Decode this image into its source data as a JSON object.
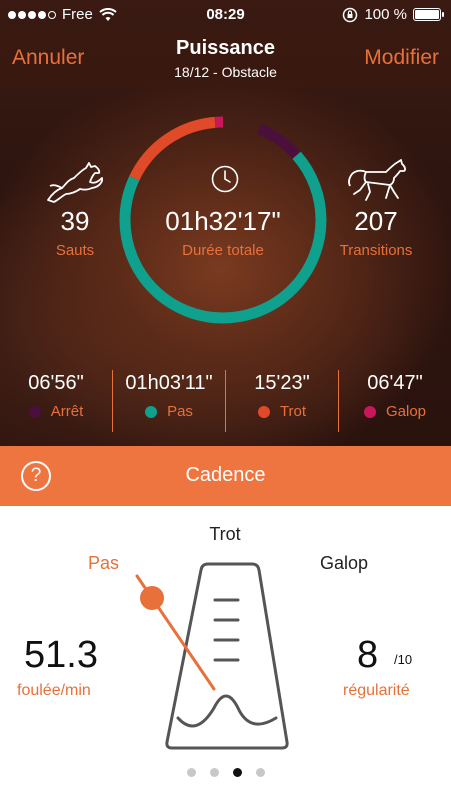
{
  "status_bar": {
    "carrier": "Free",
    "time": "08:29",
    "battery": "100 %"
  },
  "nav": {
    "cancel_label": "Annuler",
    "edit_label": "Modifier",
    "title": "Puissance",
    "subtitle": "18/12  - Obstacle"
  },
  "summary": {
    "total_duration": "01h32'17\"",
    "total_label": "Durée totale",
    "jumps_value": "39",
    "jumps_label": "Sauts",
    "transitions_value": "207",
    "transitions_label": "Transitions"
  },
  "gaits": [
    {
      "time": "06'56\"",
      "name": "Arrêt",
      "color": "#4a0f3a"
    },
    {
      "time": "01h03'11\"",
      "name": "Pas",
      "color": "#0fa08e"
    },
    {
      "time": "15'23\"",
      "name": "Trot",
      "color": "#e04a28"
    },
    {
      "time": "06'47\"",
      "name": "Galop",
      "color": "#c8185a"
    }
  ],
  "cadence": {
    "help_label": "?",
    "title": "Cadence",
    "trot_label": "Trot",
    "pas_label": "Pas",
    "galop_label": "Galop",
    "rate_value": "51.3",
    "rate_unit": "foulée/min",
    "regularity_value": "8",
    "regularity_max": "/10",
    "regularity_label": "régularité"
  },
  "pager": {
    "count": 4,
    "active_index": 2
  },
  "colors": {
    "accent": "#e8703a",
    "cadence_bar": "#ef7540"
  },
  "icons": [
    "wifi-icon",
    "lock-rotation-icon",
    "battery-icon",
    "clock-icon",
    "jumping-horse-icon",
    "trotting-horse-icon",
    "help-icon",
    "metronome-icon"
  ]
}
